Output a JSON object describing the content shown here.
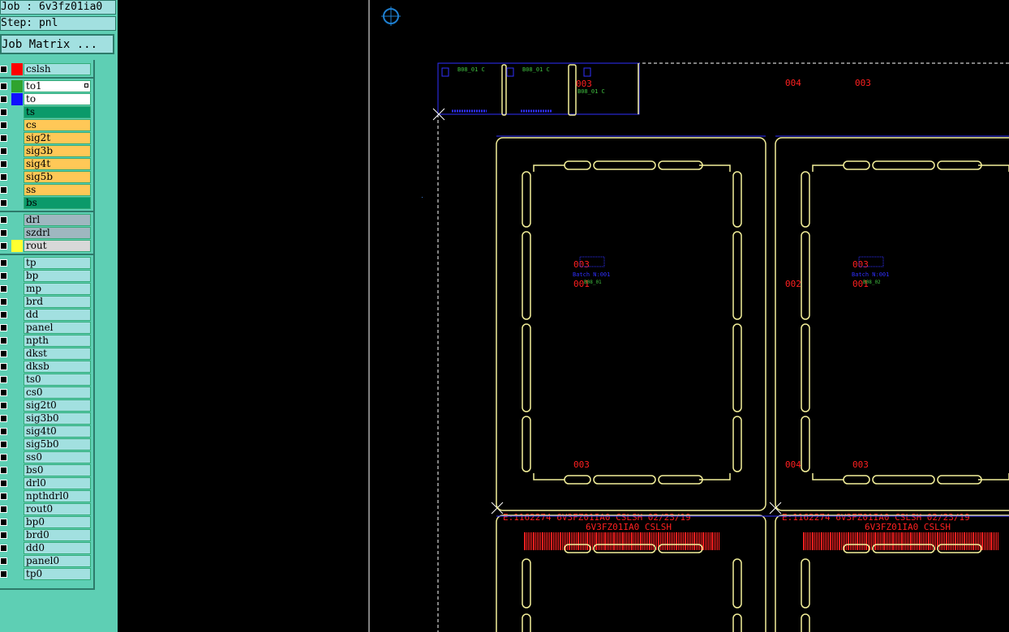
{
  "header": {
    "job": "Job : 6v3fz01ia0",
    "step": "Step: pnl",
    "job_matrix_label": "Job Matrix ..."
  },
  "layers": [
    {
      "name": "cslsh",
      "color": "#a2e0e0",
      "swatch": "#ff0000",
      "group": 0
    },
    {
      "name": "to1",
      "color": "#ffffff",
      "swatch": "#2fa32f",
      "group": 1,
      "marked": true
    },
    {
      "name": "to",
      "color": "#ffffff",
      "swatch": "#1010ff",
      "group": 1
    },
    {
      "name": "ts",
      "color": "#0b9a6a",
      "swatch": "",
      "group": 1
    },
    {
      "name": "cs",
      "color": "#ffc857",
      "swatch": "",
      "group": 1
    },
    {
      "name": "sig2t",
      "color": "#ffc857",
      "swatch": "",
      "group": 1
    },
    {
      "name": "sig3b",
      "color": "#ffc857",
      "swatch": "",
      "group": 1
    },
    {
      "name": "sig4t",
      "color": "#ffc857",
      "swatch": "",
      "group": 1
    },
    {
      "name": "sig5b",
      "color": "#ffc857",
      "swatch": "",
      "group": 1
    },
    {
      "name": "ss",
      "color": "#ffc857",
      "swatch": "",
      "group": 1
    },
    {
      "name": "bs",
      "color": "#0b9a6a",
      "swatch": "",
      "group": 1
    },
    {
      "name": "drl",
      "color": "#9fb7c0",
      "swatch": "",
      "group": 2
    },
    {
      "name": "szdrl",
      "color": "#9fb7c0",
      "swatch": "",
      "group": 2
    },
    {
      "name": "rout",
      "color": "#d8d8d8",
      "swatch": "#ffff30",
      "group": 2
    },
    {
      "name": "tp",
      "color": "#a2e0e0",
      "swatch": "",
      "group": 3
    },
    {
      "name": "bp",
      "color": "#a2e0e0",
      "swatch": "",
      "group": 3
    },
    {
      "name": "mp",
      "color": "#a2e0e0",
      "swatch": "",
      "group": 3
    },
    {
      "name": "brd",
      "color": "#a2e0e0",
      "swatch": "",
      "group": 3
    },
    {
      "name": "dd",
      "color": "#a2e0e0",
      "swatch": "",
      "group": 3
    },
    {
      "name": "panel",
      "color": "#a2e0e0",
      "swatch": "",
      "group": 3
    },
    {
      "name": "npth",
      "color": "#a2e0e0",
      "swatch": "",
      "group": 3
    },
    {
      "name": "dkst",
      "color": "#a2e0e0",
      "swatch": "",
      "group": 3
    },
    {
      "name": "dksb",
      "color": "#a2e0e0",
      "swatch": "",
      "group": 3
    },
    {
      "name": "ts0",
      "color": "#a2e0e0",
      "swatch": "",
      "group": 3
    },
    {
      "name": "cs0",
      "color": "#a2e0e0",
      "swatch": "",
      "group": 3
    },
    {
      "name": "sig2t0",
      "color": "#a2e0e0",
      "swatch": "",
      "group": 3
    },
    {
      "name": "sig3b0",
      "color": "#a2e0e0",
      "swatch": "",
      "group": 3
    },
    {
      "name": "sig4t0",
      "color": "#a2e0e0",
      "swatch": "",
      "group": 3
    },
    {
      "name": "sig5b0",
      "color": "#a2e0e0",
      "swatch": "",
      "group": 3
    },
    {
      "name": "ss0",
      "color": "#a2e0e0",
      "swatch": "",
      "group": 3
    },
    {
      "name": "bs0",
      "color": "#a2e0e0",
      "swatch": "",
      "group": 3
    },
    {
      "name": "drl0",
      "color": "#a2e0e0",
      "swatch": "",
      "group": 3
    },
    {
      "name": "npthdrl0",
      "color": "#a2e0e0",
      "swatch": "",
      "group": 3
    },
    {
      "name": "rout0",
      "color": "#a2e0e0",
      "swatch": "",
      "group": 3
    },
    {
      "name": "bp0",
      "color": "#a2e0e0",
      "swatch": "",
      "group": 3
    },
    {
      "name": "brd0",
      "color": "#a2e0e0",
      "swatch": "",
      "group": 3
    },
    {
      "name": "dd0",
      "color": "#a2e0e0",
      "swatch": "",
      "group": 3
    },
    {
      "name": "panel0",
      "color": "#a2e0e0",
      "swatch": "",
      "group": 3
    },
    {
      "name": "tp0",
      "color": "#a2e0e0",
      "swatch": "",
      "group": 3
    }
  ],
  "canvas": {
    "board_labels": {
      "top_003_a": "003",
      "top_004": "004",
      "top_003_b": "003",
      "mid_003": "003",
      "mid_001": "001",
      "mid_002": "002",
      "mid_003_b": "003",
      "mid_001_b": "001",
      "bot_003": "003",
      "bot_004": "004",
      "bot_003_b": "003",
      "batch": "Batch N:001",
      "code1": "B08_01",
      "code2": "B08_02",
      "strip_code_a": "B08_01 C",
      "strip_code_b": "B08_01 C",
      "strip_code_c": "B08_01 C"
    },
    "footer_lines": {
      "line1": "E:1162274 6V3FZ01IA0 CSLSH 02/23/19",
      "line2": "6V3FZ01IA0 CSLSH"
    },
    "colors": {
      "outline": "#f4f09a",
      "dashed": "#ffffff",
      "red": "#ff2020",
      "blue": "#3030ff",
      "green": "#40c040",
      "origin": "#1e7fd0"
    }
  }
}
